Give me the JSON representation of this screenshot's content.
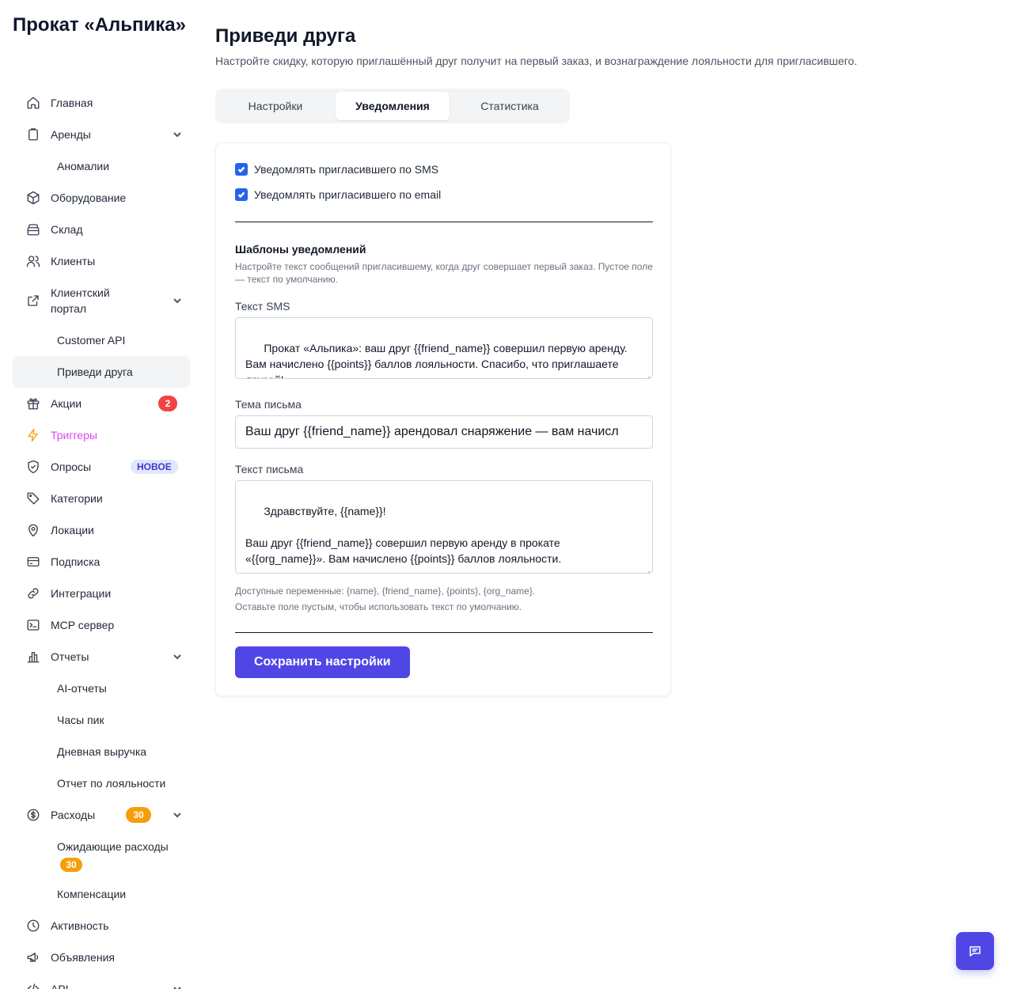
{
  "app": {
    "brand": "Прокат «Альпика»"
  },
  "sidebar": {
    "items": [
      {
        "label": "Главная",
        "icon": "home-icon"
      },
      {
        "label": "Аренды",
        "icon": "clipboard-icon"
      },
      {
        "label": "Аномалии"
      },
      {
        "label": "Оборудование",
        "icon": "box-icon"
      },
      {
        "label": "Склад",
        "icon": "warehouse-icon"
      },
      {
        "label": "Клиенты",
        "icon": "users-icon"
      },
      {
        "label": "Клиентский портал",
        "icon": "external-link-icon"
      },
      {
        "label": "Customer API"
      },
      {
        "label": "Приведи друга"
      },
      {
        "label": "Акции",
        "icon": "gift-icon",
        "badge": "2"
      },
      {
        "label": "Триггеры",
        "icon": "lightning-icon"
      },
      {
        "label": "Опросы",
        "icon": "shield-check-icon",
        "badge": "НОВОЕ"
      },
      {
        "label": "Категории",
        "icon": "tag-icon"
      },
      {
        "label": "Локации",
        "icon": "location-pin-icon"
      },
      {
        "label": "Подписка",
        "icon": "credit-card-icon"
      },
      {
        "label": "Интеграции",
        "icon": "link-icon"
      },
      {
        "label": "MCP сервер",
        "icon": "terminal-icon"
      },
      {
        "label": "Отчеты",
        "icon": "bar-chart-icon"
      },
      {
        "label": "AI-отчеты"
      },
      {
        "label": "Часы пик"
      },
      {
        "label": "Дневная выручка"
      },
      {
        "label": "Отчет по лояльности"
      },
      {
        "label": "Расходы",
        "icon": "dollar-circle-icon",
        "badge": "30"
      },
      {
        "label": "Ожидающие расходы",
        "badge": "30"
      },
      {
        "label": "Компенсации"
      },
      {
        "label": "Активность",
        "icon": "clock-icon"
      },
      {
        "label": "Объявления",
        "icon": "megaphone-icon"
      },
      {
        "label": "API",
        "icon": "code-icon"
      }
    ],
    "active": "Приведи друга",
    "colors": {
      "triggers_label": "#d946ef",
      "triggers_icon": "#f59e0b",
      "badge_red": "#ef4444",
      "badge_orange": "#f59e0b",
      "badge_new_bg": "#e0e7ff"
    }
  },
  "page": {
    "title": "Приведи друга",
    "subtitle": "Настройте скидку, которую приглашённый друг получит на первый заказ, и вознаграждение лояльности для пригласившего.",
    "tabs": [
      "Настройки",
      "Уведомления",
      "Статистика"
    ],
    "active_tab": "Уведомления"
  },
  "notifications": {
    "sms_checkbox": {
      "label": "Уведомлять пригласившего по SMS",
      "checked": true
    },
    "email_checkbox": {
      "label": "Уведомлять пригласившего по email",
      "checked": true
    },
    "templates_title": "Шаблоны уведомлений",
    "templates_desc": "Настройте текст сообщений пригласившему, когда друг совершает первый заказ. Пустое поле — текст по умолчанию.",
    "sms_label": "Текст SMS",
    "sms_value": "Прокат «Альпика»: ваш друг {{friend_name}} совершил первую аренду. Вам начислено {{points}} баллов лояльности. Спасибо, что приглашаете друзей!",
    "subject_label": "Тема письма",
    "subject_value": "Ваш друг {{friend_name}} арендовал снаряжение — вам начисл",
    "body_label": "Текст письма",
    "body_value": "Здравствуйте, {{name}}!\n\nВаш друг {{friend_name}} совершил первую аренду в прокате «{{org_name}}». Вам начислено {{points}} баллов лояльности.\n\nПриглашайте друзей — и получайте баллы за каждую их аренду!",
    "hint_vars": "Доступные переменные: {name}, {friend_name}, {points}, {org_name}.",
    "hint_default": "Оставьте поле пустым, чтобы использовать текст по умолчанию.",
    "save_label": "Сохранить настройки"
  },
  "colors": {
    "accent": "#4f46e5",
    "checkbox": "#2563eb"
  },
  "chat": {
    "icon": "chat-icon"
  }
}
